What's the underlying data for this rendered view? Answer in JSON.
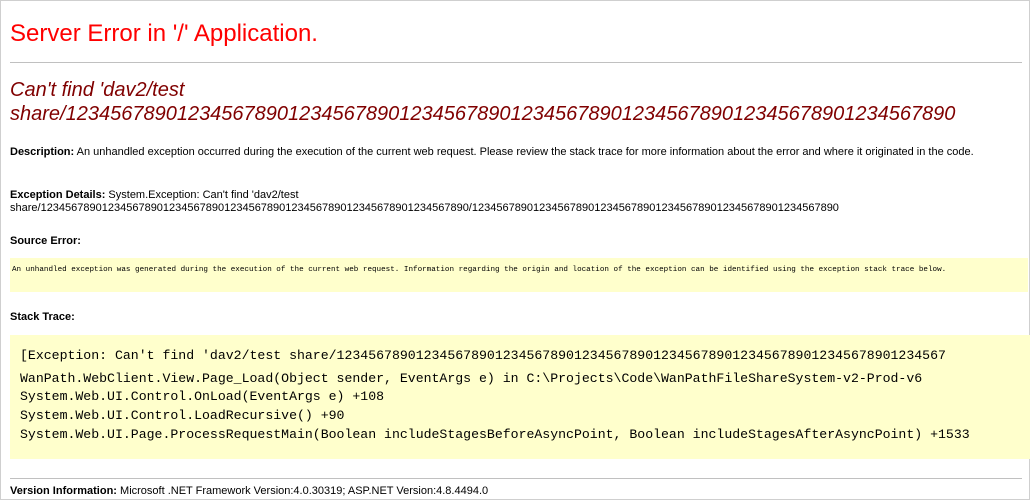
{
  "page": {
    "title": "Server Error in '/' Application.",
    "error_message_line1": "Can't find 'dav2/test",
    "error_message_line2": "share/12345678901234567890123456789012345678901234567890123456789012345678901234567890",
    "description_label": "Description:",
    "description_text": "An unhandled exception occurred during the execution of the current web request. Please review the stack trace for more information about the error and where it originated in the code.",
    "exception_label": "Exception Details:",
    "exception_line1": "System.Exception: Can't find 'dav2/test",
    "exception_line2": "share/1234567890123456789012345678901234567890123456789012345678901234567890/123456789012345678901234567890123456789012345678901234567890",
    "source_error_label": "Source Error:",
    "source_error_text": "An unhandled exception was generated during the execution of the current web request. Information regarding the origin and location of the exception can be identified using the exception stack trace below.",
    "stack_trace_label": "Stack Trace:",
    "stack_lines": [
      "[Exception: Can't find 'dav2/test share/12345678901234567890123456789012345678901234567890123456789012345678901234567",
      "   WanPath.WebClient.View.Page_Load(Object sender, EventArgs e) in C:\\Projects\\Code\\WanPathFileShareSystem-v2-Prod-v6",
      "   System.Web.UI.Control.OnLoad(EventArgs e) +108",
      "   System.Web.UI.Control.LoadRecursive() +90",
      "   System.Web.UI.Page.ProcessRequestMain(Boolean includeStagesBeforeAsyncPoint, Boolean includeStagesAfterAsyncPoint) +1533"
    ],
    "version_label": "Version Information:",
    "version_text": "Microsoft .NET Framework Version:4.0.30319; ASP.NET Version:4.8.4494.0"
  },
  "colors": {
    "title": "#ff0000",
    "error_message": "#800000",
    "code_background": "#ffffcc",
    "rule": "#c0c0c0"
  }
}
